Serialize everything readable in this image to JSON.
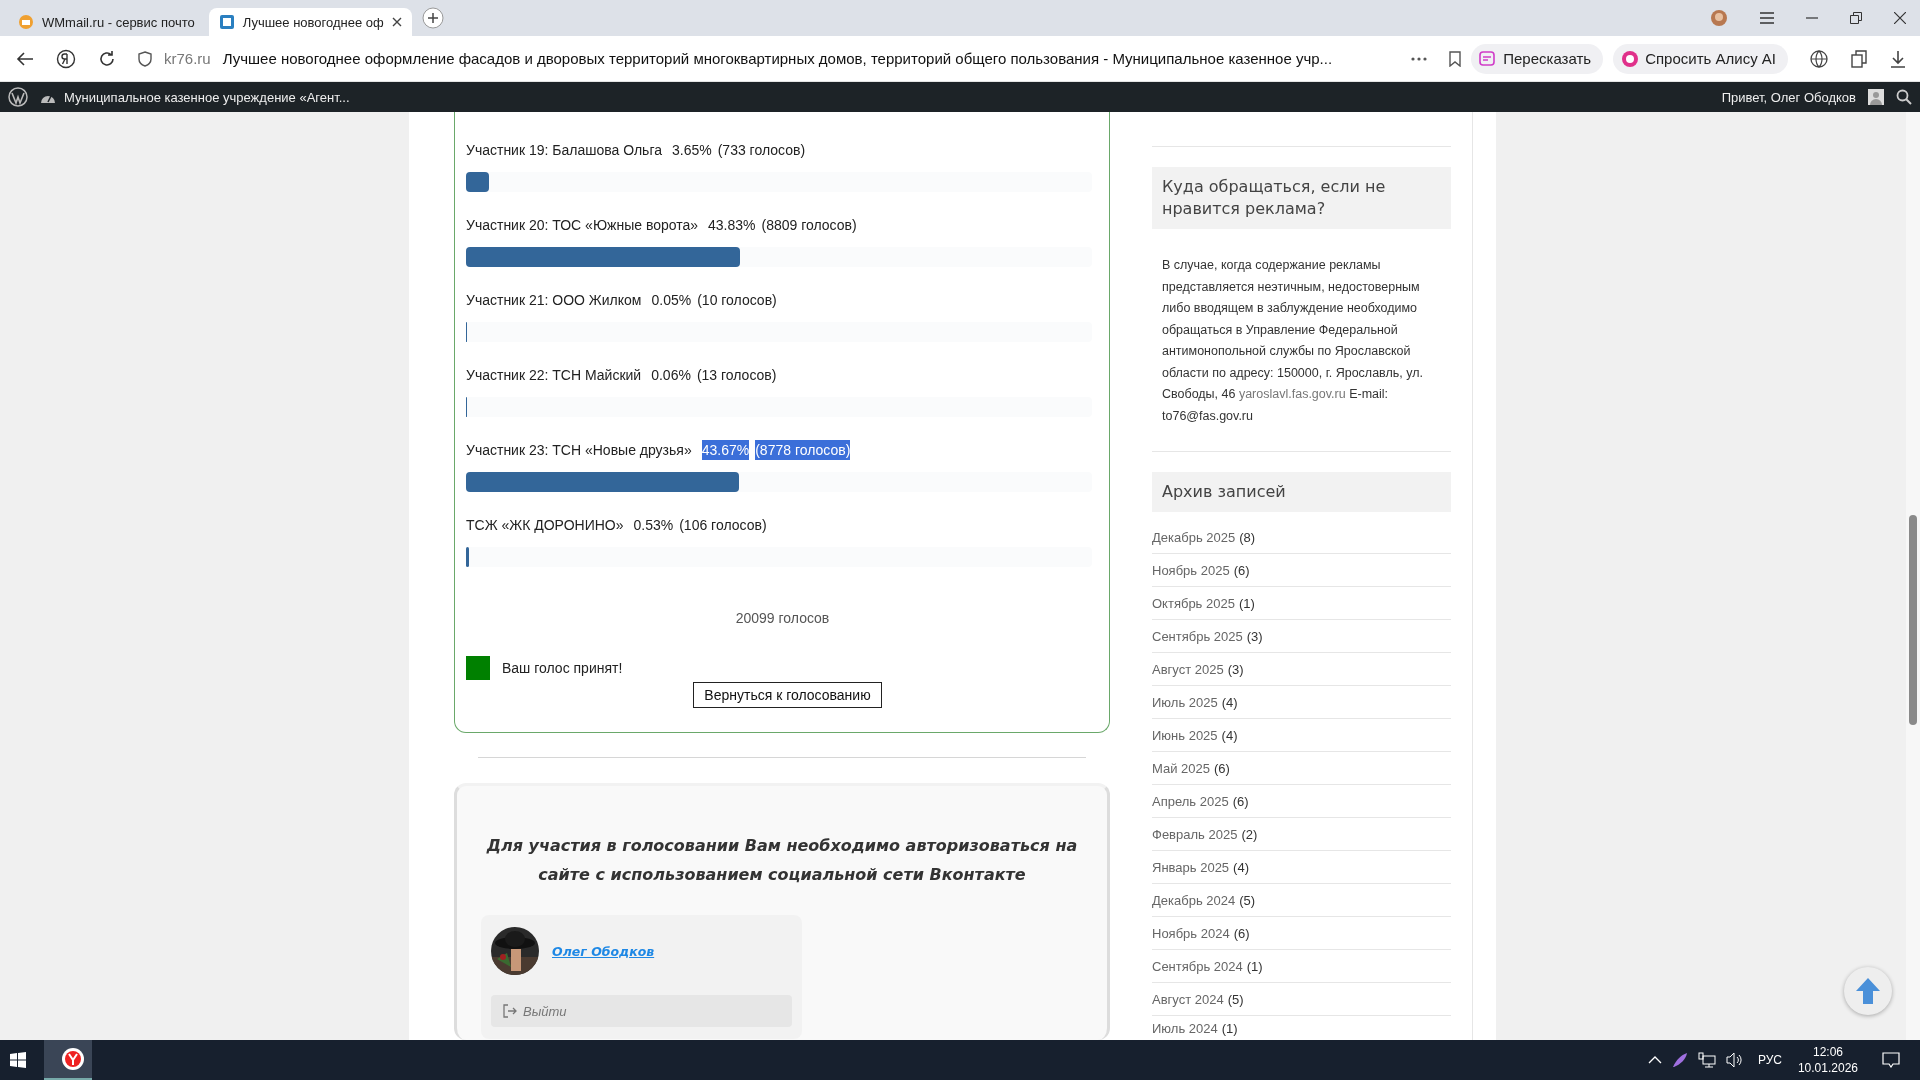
{
  "browser": {
    "tabs": [
      {
        "title": "WMmail.ru - сервис почто",
        "selected": false
      },
      {
        "title": "Лучшее новогоднее оф",
        "selected": true
      }
    ],
    "address": {
      "domain": "kr76.ru",
      "title": "Лучшее новогоднее оформление фасадов и дворовых территорий многоквартирных домов, территорий общего пользования - Муниципальное казенное учр..."
    },
    "actions": [
      "Пересказать",
      "Спросить Алису AI"
    ]
  },
  "admin_bar": {
    "site": "Муниципальное казенное учреждение «Агент...",
    "greeting": "Привет, Олег Ободков"
  },
  "poll": {
    "rows": [
      {
        "label": "Участник 19: Балашова Ольга",
        "percent": "3.65%",
        "votes": "(733 голосов)",
        "level": 0.0365,
        "highlighted": false
      },
      {
        "label": "Участник 20: ТОС «Южные ворота»",
        "percent": "43.83%",
        "votes": "(8809 голосов)",
        "level": 0.4383,
        "highlighted": false
      },
      {
        "label": "Участник 21: ООО Жилком",
        "percent": "0.05%",
        "votes": "(10 голосов)",
        "level": 0.0005,
        "highlighted": false
      },
      {
        "label": "Участник 22: ТСН Майский",
        "percent": "0.06%",
        "votes": "(13 голосов)",
        "level": 0.0006,
        "highlighted": false
      },
      {
        "label": "Участник 23: ТСН «Новые друзья»",
        "percent": "43.67%",
        "votes": "(8778 голосов)",
        "level": 0.4367,
        "highlighted": true
      },
      {
        "label": "ТСЖ «ЖК ДОРОНИНО»",
        "percent": "0.53%",
        "votes": "(106 голосов)",
        "level": 0.0053,
        "highlighted": false
      }
    ],
    "total": "20099 голосов",
    "notice": "Ваш голос принят!",
    "back_button": "Вернуться к голосованию"
  },
  "auth": {
    "message": "Для участия в голосовании Вам необходимо авторизоваться на сайте с использованием социальной сети Вконтакте",
    "user_name": "Олег Ободков",
    "logout": "Выйти"
  },
  "sidebar": {
    "ad_widget": {
      "title": "Куда обращаться, если не нравится реклама?",
      "text": "В случае, когда содержание рекламы представляется неэтичным, недостоверным либо вводящем в заблуждение необходимо обращаться в Управление Федеральной антимонопольной службы по Ярославской области по адресу: 150000, г. Ярославль, ул. Свободы, 46 ",
      "link": "yaroslavl.fas.gov.ru",
      "text_after": " E-mail: to76@fas.gov.ru"
    },
    "archive": {
      "title": "Архив записей",
      "items": [
        {
          "month": "Декабрь 2025",
          "count": "(8)"
        },
        {
          "month": "Ноябрь 2025",
          "count": "(6)"
        },
        {
          "month": "Октябрь 2025",
          "count": "(1)"
        },
        {
          "month": "Сентябрь 2025",
          "count": "(3)"
        },
        {
          "month": "Август 2025",
          "count": "(3)"
        },
        {
          "month": "Июль 2025",
          "count": "(4)"
        },
        {
          "month": "Июнь 2025",
          "count": "(4)"
        },
        {
          "month": "Май 2025",
          "count": "(6)"
        },
        {
          "month": "Апрель 2025",
          "count": "(6)"
        },
        {
          "month": "Февраль 2025",
          "count": "(2)"
        },
        {
          "month": "Январь 2025",
          "count": "(4)"
        },
        {
          "month": "Декабрь 2024",
          "count": "(5)"
        },
        {
          "month": "Ноябрь 2024",
          "count": "(6)"
        },
        {
          "month": "Сентябрь 2024",
          "count": "(1)"
        },
        {
          "month": "Август 2024",
          "count": "(5)"
        },
        {
          "month": "Июль 2024",
          "count": "(1)"
        }
      ]
    }
  },
  "taskbar": {
    "language": "РУС",
    "time": "12:06",
    "date": "10.01.2026"
  }
}
